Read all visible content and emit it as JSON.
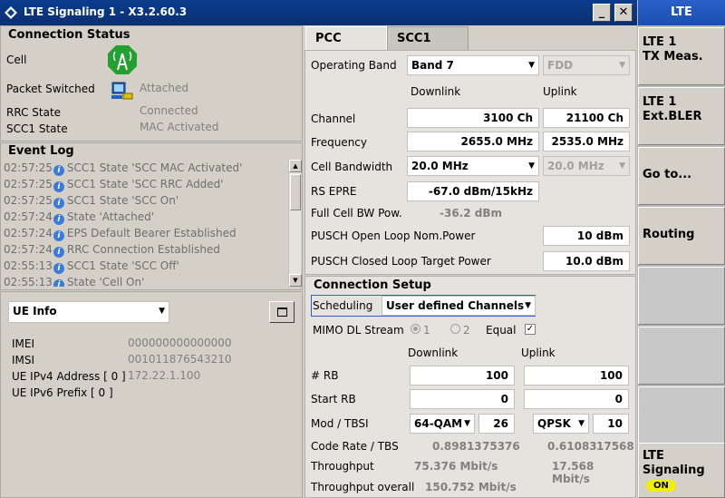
{
  "window": {
    "title": "LTE Signaling 1 - X3.2.60.3",
    "min_label": "_",
    "close_label": "✕"
  },
  "connection_status": {
    "title": "Connection Status",
    "cell_label": "Cell",
    "ps_label": "Packet Switched",
    "ps_value": "Attached",
    "rrc_label": "RRC State",
    "rrc_value": "Connected",
    "scc1_label": "SCC1 State",
    "scc1_value": "MAC Activated"
  },
  "event_log": {
    "title": "Event Log",
    "entries": [
      {
        "time": "02:57:25",
        "text": "SCC1 State 'SCC MAC Activated'"
      },
      {
        "time": "02:57:25",
        "text": "SCC1 State 'SCC RRC Added'"
      },
      {
        "time": "02:57:25",
        "text": "SCC1 State 'SCC On'"
      },
      {
        "time": "02:57:24",
        "text": "State 'Attached'"
      },
      {
        "time": "02:57:24",
        "text": "EPS Default Bearer Established"
      },
      {
        "time": "02:57:24",
        "text": "RRC Connection Established"
      },
      {
        "time": "02:55:13",
        "text": "SCC1 State 'SCC Off'"
      },
      {
        "time": "02:55:13",
        "text": "State 'Cell On'"
      }
    ]
  },
  "ue_info": {
    "selector": "UE Info",
    "imei_label": "IMEI",
    "imei": "000000000000000",
    "imsi_label": "IMSI",
    "imsi": "001011876543210",
    "ipv4_label": "UE IPv4 Address [ 0 ]",
    "ipv4": "172.22.1.100",
    "ipv6_label": "UE IPv6 Prefix [ 0 ]"
  },
  "tabs": [
    {
      "label": "PCC"
    },
    {
      "label": "SCC1"
    }
  ],
  "pcc": {
    "operating_band_label": "Operating Band",
    "operating_band": "Band 7",
    "duplex": "FDD",
    "downlink_label": "Downlink",
    "uplink_label": "Uplink",
    "channel_label": "Channel",
    "channel_dl": "3100  Ch",
    "channel_ul": "21100  Ch",
    "frequency_label": "Frequency",
    "frequency_dl": "2655.0  MHz",
    "frequency_ul": "2535.0  MHz",
    "bandwidth_label": "Cell Bandwidth",
    "bandwidth_dl": "20.0 MHz",
    "bandwidth_ul": "20.0 MHz",
    "rs_epre_label": "RS EPRE",
    "rs_epre": "-67.0  dBm/15kHz",
    "full_bw_label": "Full Cell BW Pow.",
    "full_bw_value": "-36.2  dBm",
    "pusch_ol_label": "PUSCH Open Loop Nom.Power",
    "pusch_ol_value": "10  dBm",
    "pusch_cl_label": "PUSCH Closed Loop Target Power",
    "pusch_cl_value": "10.0  dBm"
  },
  "connection_setup": {
    "title": "Connection Setup",
    "scheduling_label": "Scheduling",
    "scheduling_value": "User defined Channels",
    "mimo_label": "MIMO DL Stream",
    "mimo_opt1": "1",
    "mimo_opt2": "2",
    "equal_label": "Equal",
    "downlink_label": "Downlink",
    "uplink_label": "Uplink",
    "rb_label": "# RB",
    "rb_dl": "100",
    "rb_ul": "100",
    "start_rb_label": "Start RB",
    "start_rb_dl": "0",
    "start_rb_ul": "0",
    "mod_label": "Mod / TBSI",
    "mod_dl": "64-QAM",
    "tbsi_dl": "26",
    "mod_ul": "QPSK",
    "tbsi_ul": "10",
    "code_rate_label": "Code Rate / TBS",
    "code_rate_dl": "0.89813",
    "tbs_dl": "75376",
    "code_rate_ul": "0.61083",
    "tbs_ul": "17568",
    "throughput_label": "Throughput",
    "throughput_dl": "75.376  Mbit/s",
    "throughput_ul": "17.568  Mbit/s",
    "throughput_overall_label": "Throughput overall",
    "throughput_overall": "150.752  Mbit/s"
  },
  "softkeys": {
    "header": "LTE",
    "k1": "LTE 1\nTX Meas.",
    "k2": "LTE 1\nExt.BLER",
    "k3": "Go to...",
    "k4": "Routing",
    "k8_title": "LTE\nSignaling",
    "k8_badge": "ON"
  },
  "colors": {
    "title_bar": "#0a3c8c",
    "softkey_header": "#1a4fb0",
    "badge": "#f0f000",
    "info_icon": "#3a7ad8",
    "cell_icon": "#22a030"
  }
}
